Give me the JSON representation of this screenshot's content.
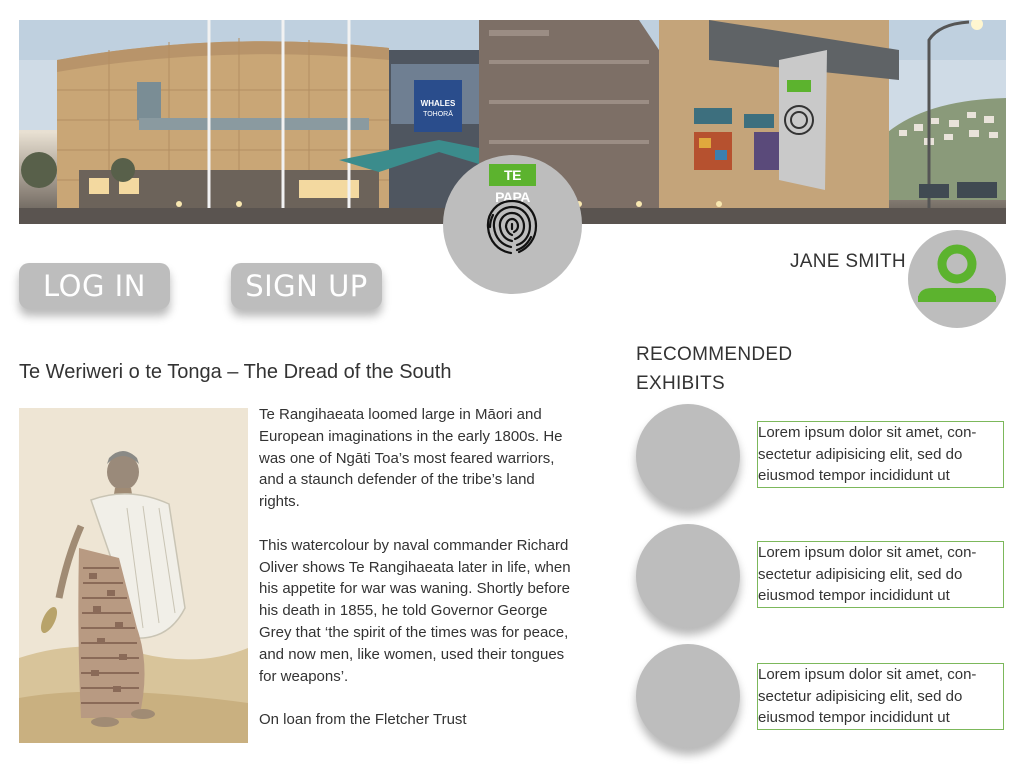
{
  "hero": {
    "image": "te-papa-museum-building-photo",
    "banner_text": "WHALES TOHORĀ"
  },
  "logo": {
    "brand_text": "TE PAPA",
    "icon": "fingerprint-icon"
  },
  "auth": {
    "login_label": "LOG IN",
    "signup_label": "SIGN UP"
  },
  "user": {
    "name": "JANE SMITH",
    "avatar_icon": "user-icon"
  },
  "article": {
    "title": "Te Weriweri o te Tonga – The Dread of the South",
    "image": "watercolour-portrait-te-rangihaeata",
    "paragraphs": [
      "Te Rangihaeata loomed large in Māori and European imaginations in the early 1800s. He was one of Ngāti Toa’s most feared warriors, and a staunch defender of the tribe’s land rights.",
      "This watercolour by naval commander Richard Oliver shows Te Rangihaeata later in life, when his appetite for war was waning. Shortly before his death in 1855, he told Governor George Grey that ‘the spirit of the times was for peace, and now men, like women, used their tongues for weapons’.",
      "On loan from the Fletcher Trust"
    ]
  },
  "recommended": {
    "heading_line1": "RECOMMENDED",
    "heading_line2": "EXHIBITS",
    "items": [
      {
        "text": "Lorem ipsum dolor sit amet, con-sectetur adipisicing elit, sed do eiusmod tempor incididunt ut"
      },
      {
        "text": "Lorem ipsum dolor sit amet, con-sectetur adipisicing elit, sed do eiusmod tempor incididunt ut"
      },
      {
        "text": "Lorem ipsum dolor sit amet, con-sectetur adipisicing elit, sed do eiusmod tempor incididunt ut"
      }
    ]
  },
  "colors": {
    "accent_green": "#5cb32e",
    "placeholder_gray": "#bdbdbd",
    "text": "#333333",
    "box_border_green": "#7cb85b"
  }
}
